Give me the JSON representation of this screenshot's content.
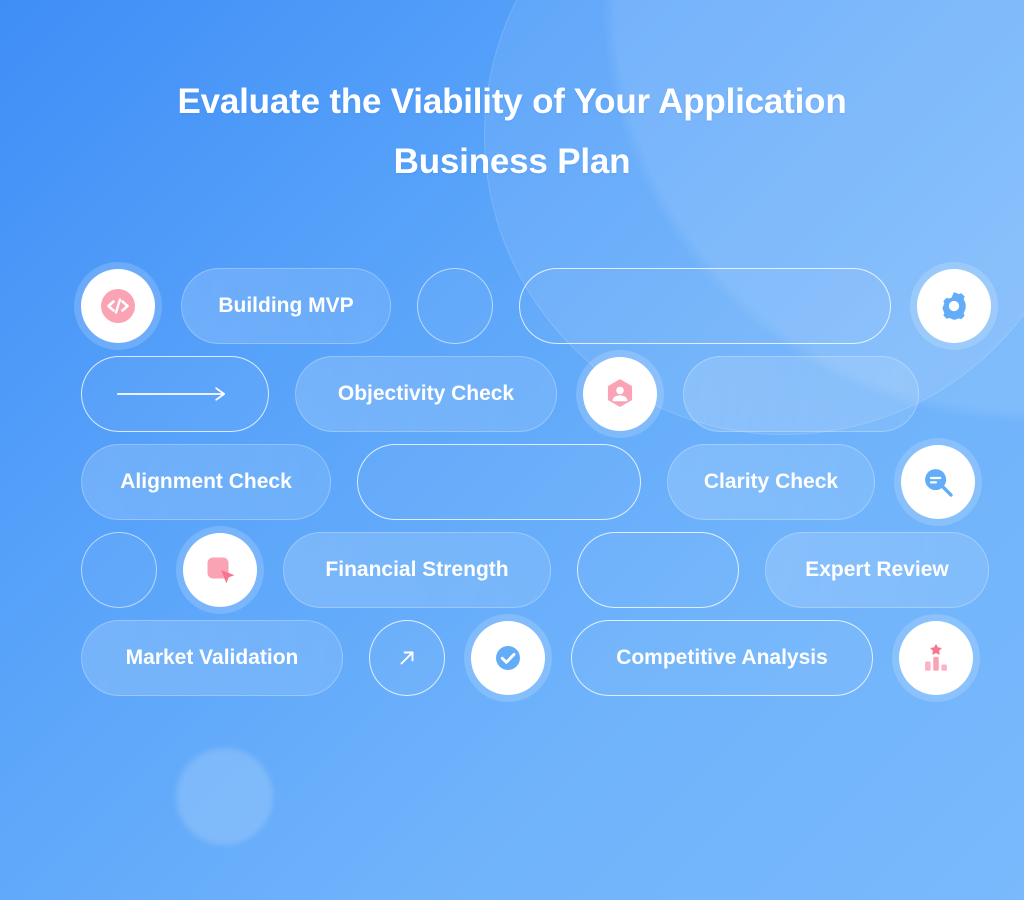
{
  "theme": {
    "bg_from": "#3f8ef7",
    "bg_to": "#79b9fc",
    "text_color": "#ffffff",
    "accent_pink": "#f9a3b4",
    "accent_pink_dark": "#f7758f",
    "accent_blue": "#63adf8"
  },
  "title": {
    "line1": "Evaluate the Viability of Your Application",
    "line2": "Business Plan"
  },
  "rows": [
    {
      "items": [
        {
          "kind": "icon",
          "icon": "code-icon",
          "label": ""
        },
        {
          "kind": "pill-filled",
          "label": "Building MVP"
        },
        {
          "kind": "circle-empty",
          "label": ""
        },
        {
          "kind": "pill-outline",
          "label": ""
        },
        {
          "kind": "icon",
          "icon": "gear-icon",
          "label": ""
        }
      ]
    },
    {
      "items": [
        {
          "kind": "pill-outline-arrow",
          "label": "",
          "icon": "arrow-right-icon"
        },
        {
          "kind": "pill-filled",
          "label": "Objectivity Check"
        },
        {
          "kind": "icon",
          "icon": "user-badge-icon",
          "label": ""
        },
        {
          "kind": "pill-filled-empty",
          "label": ""
        }
      ]
    },
    {
      "items": [
        {
          "kind": "pill-filled",
          "label": "Alignment Check"
        },
        {
          "kind": "pill-outline",
          "label": ""
        },
        {
          "kind": "pill-filled",
          "label": "Clarity Check"
        },
        {
          "kind": "icon",
          "icon": "search-analysis-icon",
          "label": ""
        }
      ]
    },
    {
      "items": [
        {
          "kind": "circle-empty",
          "label": ""
        },
        {
          "kind": "icon",
          "icon": "cursor-click-icon",
          "label": ""
        },
        {
          "kind": "pill-filled",
          "label": "Financial Strength"
        },
        {
          "kind": "pill-outline",
          "label": ""
        },
        {
          "kind": "pill-filled",
          "label": "Expert Review"
        }
      ]
    },
    {
      "items": [
        {
          "kind": "pill-filled",
          "label": "Market Validation"
        },
        {
          "kind": "circle-outline-arrow",
          "label": "",
          "icon": "arrow-up-right-icon"
        },
        {
          "kind": "icon",
          "icon": "check-circle-icon",
          "label": ""
        },
        {
          "kind": "pill-outline",
          "label": "Competitive Analysis"
        },
        {
          "kind": "icon",
          "icon": "ranking-chart-icon",
          "label": ""
        }
      ]
    }
  ]
}
